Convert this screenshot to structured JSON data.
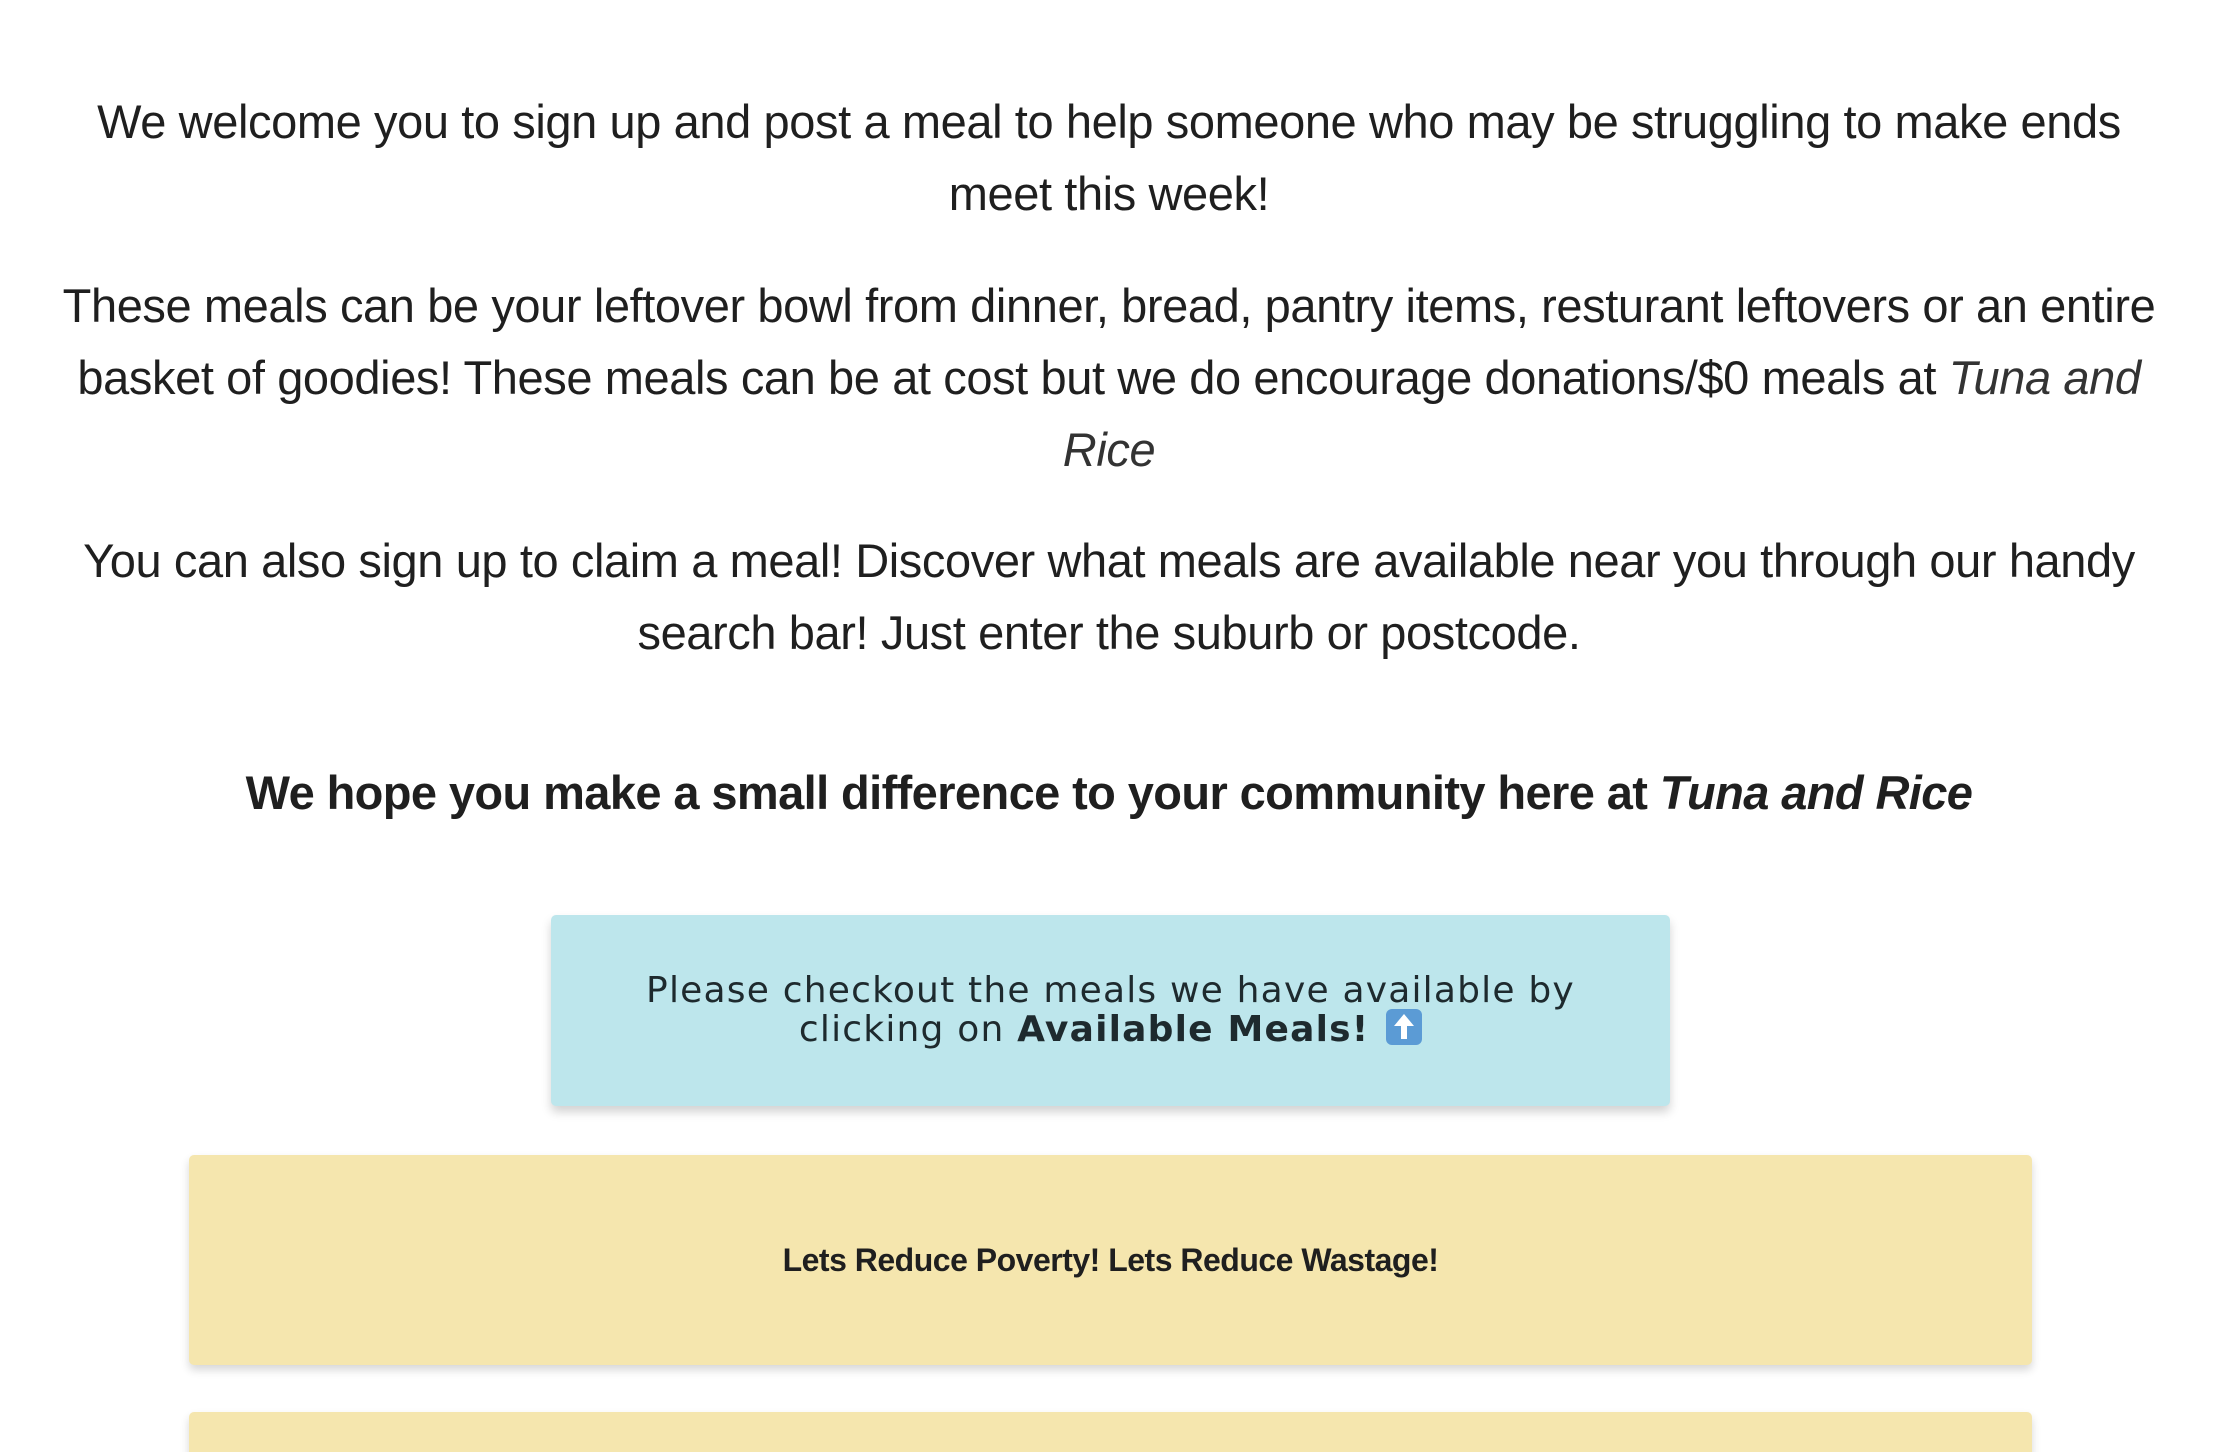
{
  "intro": {
    "p1": "We welcome you to sign up and post a meal to help someone who may be struggling to make ends meet this week!",
    "p2_main": "These meals can be your leftover bowl from dinner, bread, pantry items, resturant leftovers or an entire basket of goodies! These meals can be at cost but we do encourage donations/$0 meals at ",
    "p2_brand": "Tuna and Rice",
    "p3": "You can also sign up to claim a meal! Discover what meals are available near you through our handy search bar! Just enter the suburb or postcode."
  },
  "hope": {
    "text": "We hope you make a small difference to your community here at ",
    "brand": "Tuna and Rice"
  },
  "info_box": {
    "line1": "Please checkout the meals we have available by",
    "line2_prefix": "clicking on ",
    "link_text": "Available Meals!",
    "icon": "up-arrow-icon",
    "background": "#bde6ec"
  },
  "banner": {
    "text": "Lets Reduce Poverty! Lets Reduce Wastage!",
    "background": "#f5e6ae"
  }
}
